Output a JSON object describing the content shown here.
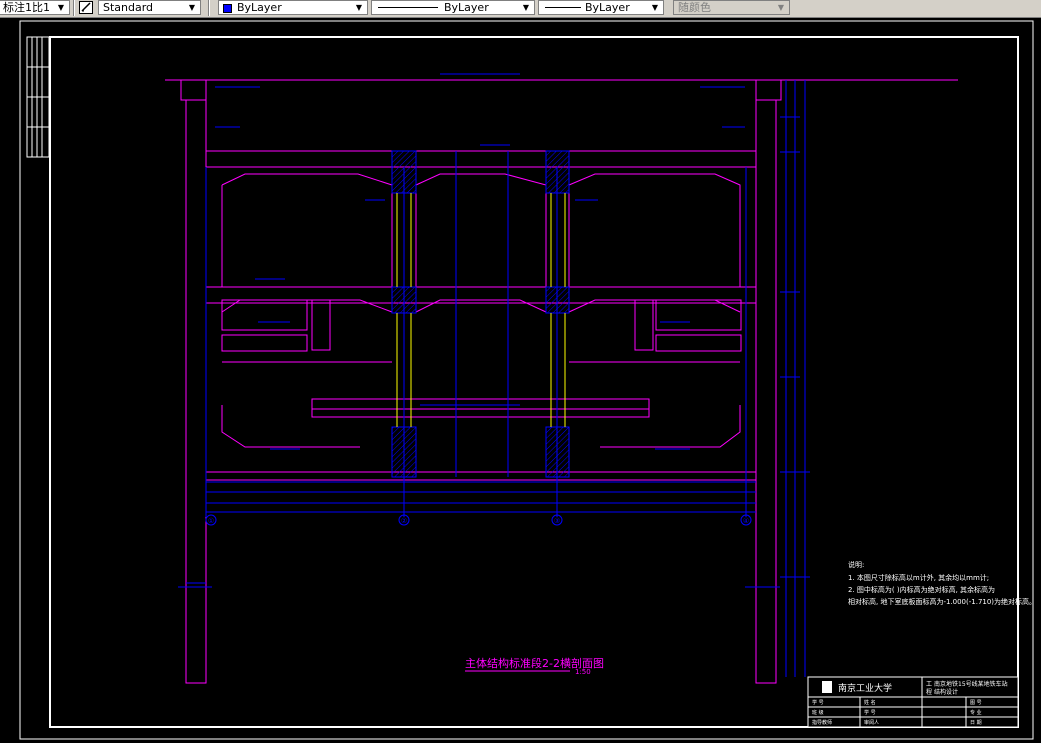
{
  "toolbar": {
    "dim_style": "标注1比1",
    "text_style": "Standard",
    "layer_color": "ByLayer",
    "linetype": "ByLayer",
    "lineweight": "ByLayer",
    "plot_style": "随颜色",
    "icons": {
      "style_icon": "pencil-style-icon",
      "dropdown": "chevron-down-icon"
    }
  },
  "colors": {
    "background": "#000000",
    "structure": "#ff00ff",
    "dimension": "#0000ff",
    "column": "#ffffff",
    "rebar": "#ffff00",
    "frame": "#ffffff",
    "swatch_bylayer": "#0000ff"
  },
  "drawing": {
    "title": "主体结构标准段2-2横剖面图",
    "scale": "1:50",
    "notes_heading": "说明:",
    "notes": [
      "1. 本图尺寸除标高以m计外, 其余均以mm计;",
      "2. 图中标高为(  )内标高为绝对标高, 其余标高为",
      "   相对标高, 地下室底板面标高为-1.000(-1.710)为绝对标高。"
    ],
    "axis_labels": [
      "①",
      "②",
      "③",
      "④"
    ]
  },
  "title_block": {
    "school": "南京工业大学",
    "project_label_1": "工",
    "project_label_2": "程",
    "project_name": "南京地铁15号线某地铁车站",
    "project_sub": "结构设计",
    "rows": [
      {
        "left": "学  号",
        "mid": "姓  名",
        "right": "图  号"
      },
      {
        "left": "班  级",
        "mid": "学  号",
        "right": "专  业"
      },
      {
        "left": "指导教师",
        "mid": "审阅人",
        "right": "日  期"
      }
    ]
  }
}
